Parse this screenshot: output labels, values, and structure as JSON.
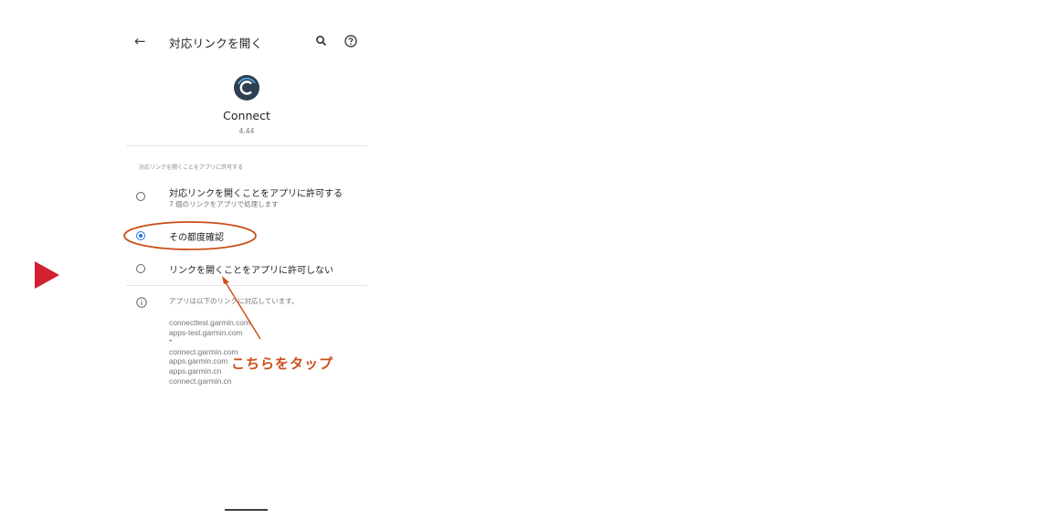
{
  "app_bar": {
    "title": "対応リンクを開く",
    "back_icon": "arrow-left-icon",
    "search_icon": "search-icon",
    "help_icon": "help-icon"
  },
  "app_info": {
    "name": "Connect",
    "version": "4.44"
  },
  "section_label": "対応リンクを開くことをアプリに許可する",
  "options": [
    {
      "label": "対応リンクを開くことをアプリに許可する",
      "sublabel": "7 個のリンクをアプリで処理します",
      "selected": false
    },
    {
      "label": "その都度確認",
      "selected": true
    },
    {
      "label": "リンクを開くことをアプリに許可しない",
      "selected": false
    }
  ],
  "info": {
    "text": "アプリは以下のリンクに対応しています。",
    "domains": [
      "connecttest.garmin.com",
      "apps-test.garmin.com",
      "*",
      "connect.garmin.com",
      "apps.garmin.com",
      "apps.garmin.cn",
      "connect.garmin.cn"
    ]
  },
  "annotation": {
    "text": "こちらをタップ",
    "color": "#cc4f19"
  },
  "colors": {
    "accent": "#1a73e8",
    "marker": "#d1202f",
    "app_icon_bg": "#2e3f52"
  }
}
